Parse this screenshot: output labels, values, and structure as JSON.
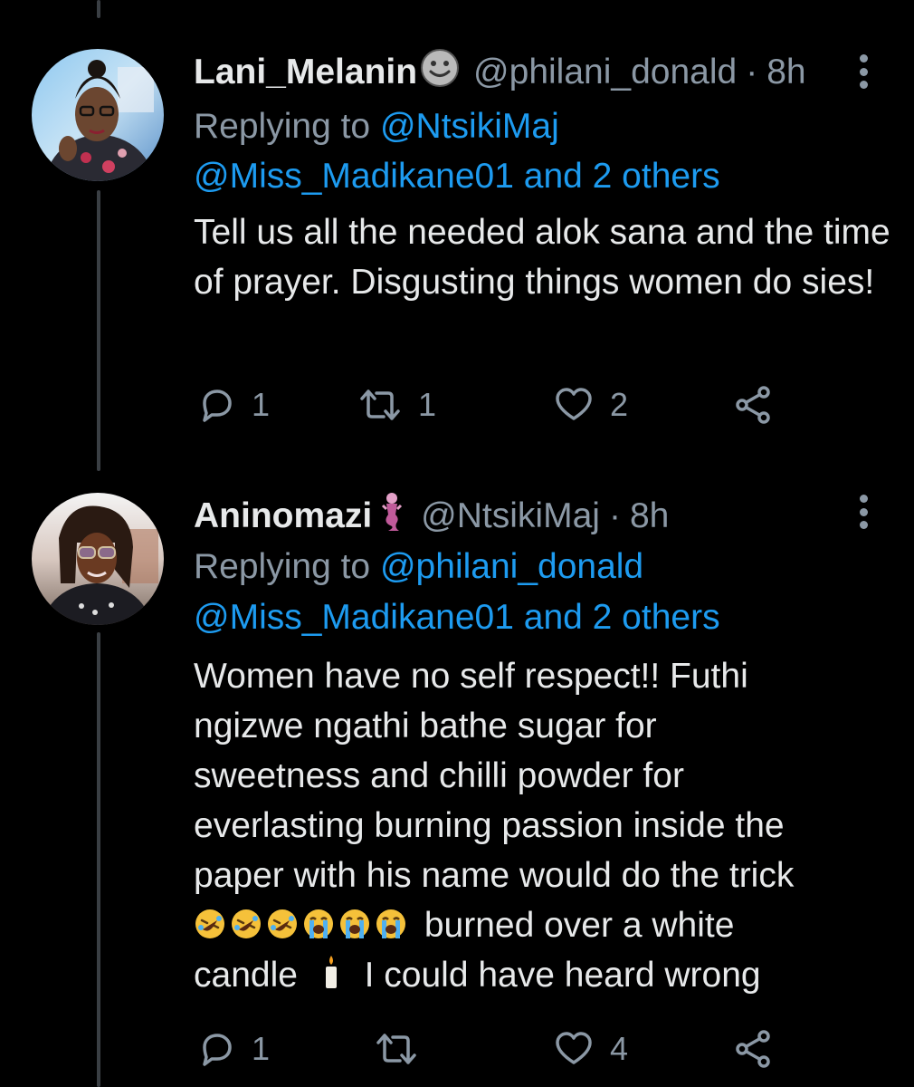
{
  "tweets": [
    {
      "display_name": "Lani_Melanin",
      "name_emoji": "🙂",
      "handle": "@philani_donald",
      "separator": "·",
      "time": "8h",
      "replying_prefix": "Replying to",
      "replying_to": "@NtsikiMaj",
      "replying_more": "@Miss_Madikane01 and 2 others",
      "text": "Tell us all the needed alok sana and the time of prayer. Disgusting things women do sies!",
      "reply_count": "1",
      "retweet_count": "1",
      "like_count": "2"
    },
    {
      "display_name": "Aninomazi",
      "name_emoji": "🧜",
      "handle": "@NtsikiMaj",
      "separator": "·",
      "time": "8h",
      "replying_prefix": "Replying to",
      "replying_to": "@philani_donald",
      "replying_more": "@Miss_Madikane01 and 2 others",
      "text_lines": [
        "Women have no self respect!! Futhi",
        "ngizwe ngathi bathe sugar for",
        "sweetness and chilli powder for",
        "everlasting burning passion inside the",
        "paper with his name would do the trick"
      ],
      "text_after_emojis": "burned over a white",
      "text_candle_before": "candle",
      "text_candle_after": "I could have heard wrong",
      "reply_count": "1",
      "retweet_count": "",
      "like_count": "4"
    }
  ],
  "colors": {
    "background": "#000000",
    "primary_text": "#e7e9ea",
    "secondary_text": "#8b98a5",
    "link": "#1d9bf0"
  },
  "icons": [
    "reply-icon",
    "retweet-icon",
    "like-icon",
    "share-icon",
    "more-icon",
    "rofl-emoji",
    "sob-emoji",
    "candle-emoji"
  ]
}
